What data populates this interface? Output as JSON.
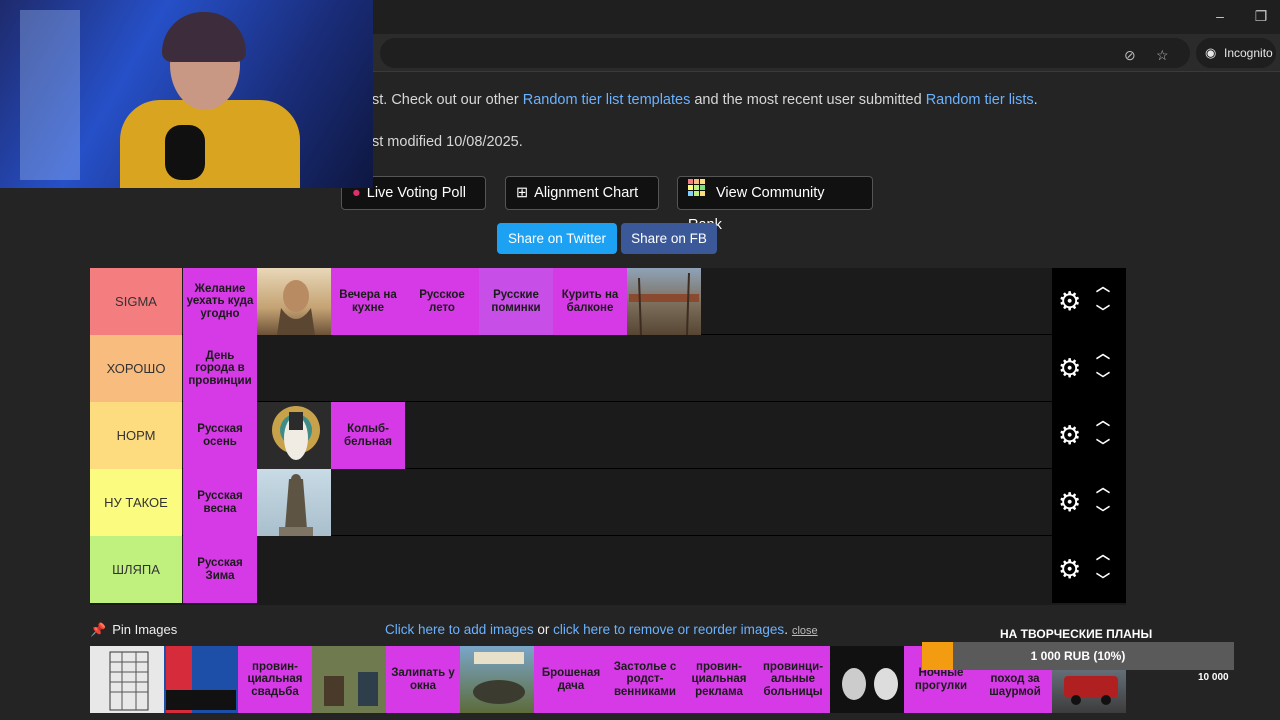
{
  "browser": {
    "incognito_label": "Incognito"
  },
  "page": {
    "desc_line1_prefix": "st. Check out our other ",
    "desc_link1": "Random tier list templates",
    "desc_line1_mid": " and the most recent user submitted ",
    "desc_link2": "Random tier lists",
    "desc_line1_suffix": ".",
    "desc_line2": "st modified 10/08/2025.",
    "buttons": {
      "live_poll": "Live Voting Poll",
      "alignment": "Alignment Chart",
      "community": "View Community Rank"
    },
    "share": {
      "twitter": "Share on Twitter",
      "fb": "Share on FB"
    }
  },
  "tiers": [
    {
      "label": "SIGMA",
      "color": "#f47d7f",
      "items": [
        "Желание уехать куда угодно",
        "",
        "Вечера на кухне",
        "Русское лето",
        "Русские поминки",
        "Курить на балконе",
        ""
      ]
    },
    {
      "label": "ХОРОШО",
      "color": "#f9bc7f",
      "items": [
        "День города в провинции"
      ]
    },
    {
      "label": "НОРМ",
      "color": "#fcdc7f",
      "items": [
        "Русская осень",
        "",
        "Колыб-бельная"
      ]
    },
    {
      "label": "НУ ТАКОЕ",
      "color": "#fbfb7f",
      "items": [
        "Русская весна",
        ""
      ]
    },
    {
      "label": "ШЛЯПА",
      "color": "#c0f17f",
      "items": [
        "Русская Зима"
      ]
    }
  ],
  "bottom": {
    "pin_label": "Pin Images",
    "add_link": "Click here to add images",
    "or": " or ",
    "remove_link": "click here to remove or reorder images",
    "period": ".",
    "close": "close",
    "pool": [
      "",
      "",
      "провин-циальная свадьба",
      "",
      "Залипать у окна",
      "",
      "Брошеная дача",
      "Застолье с родст-венниками",
      "провин-циальная реклама",
      "провинци-альные больницы",
      "",
      "Ночные прогулки",
      "Ночной поход за шаурмой",
      ""
    ]
  },
  "donation": {
    "title": "НА ТВОРЧЕСКИЕ ПЛАНЫ",
    "amount": "1 000 RUB (10%)",
    "progress": 0.1,
    "goal": "10 000"
  }
}
